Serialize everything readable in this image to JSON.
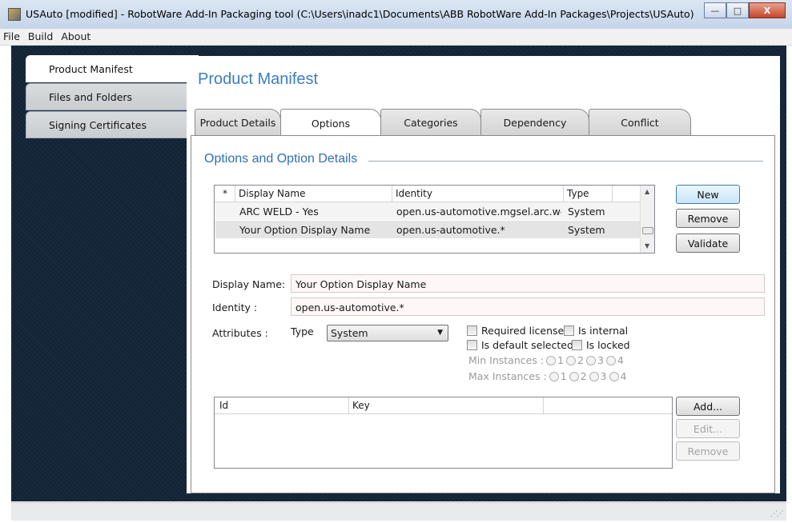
{
  "window": {
    "title": "USAuto [modified] - RobotWare Add-In Packaging tool (C:\\Users\\inadc1\\Documents\\ABB RobotWare Add-In Packages\\Projects\\USAuto)",
    "controls": {
      "minimize": "—",
      "maximize": "□",
      "close": "X"
    }
  },
  "menu": [
    "File",
    "Build",
    "About"
  ],
  "nav": [
    {
      "label": "Product Manifest",
      "active": true
    },
    {
      "label": "Files and Folders",
      "active": false
    },
    {
      "label": "Signing Certificates",
      "active": false
    }
  ],
  "page_title": "Product Manifest",
  "tabs": [
    "Product Details",
    "Options",
    "Categories",
    "Dependency",
    "Conflict"
  ],
  "active_tab": "Options",
  "section_title": "Options and Option Details",
  "options_grid": {
    "columns": [
      "*",
      "Display Name",
      "Identity",
      "Type"
    ],
    "rows": [
      {
        "display_name": "ARC WELD - Yes",
        "identity": "open.us-automotive.mgsel.arc.weld",
        "type": "System"
      },
      {
        "display_name": "Your Option Display Name",
        "identity": "open.us-automotive.*",
        "type": "System"
      }
    ]
  },
  "grid_buttons": {
    "new": "New",
    "remove": "Remove",
    "validate": "Validate"
  },
  "form": {
    "display_name_label": "Display Name:",
    "display_name_value": "Your Option Display Name",
    "identity_label": "Identity :",
    "identity_value": "open.us-automotive.*",
    "attributes_label": "Attributes :",
    "type_label": "Type",
    "type_value": "System",
    "required_license": "Required license",
    "is_internal": "Is internal",
    "is_default_selected": "Is default selected",
    "is_locked": "Is locked",
    "min_instances_label": "Min Instances :",
    "max_instances_label": "Max Instances :",
    "instance_options": [
      "1",
      "2",
      "3",
      "4"
    ]
  },
  "keys_grid": {
    "columns": [
      "Id",
      "Key"
    ]
  },
  "keys_buttons": {
    "add": "Add...",
    "edit": "Edit...",
    "remove": "Remove"
  },
  "colors": {
    "accent": "#3b7ec0",
    "frame_bg": "#122336",
    "tab_border": "#8a8a8a"
  },
  "icons": [
    "app-icon",
    "minimize-icon",
    "maximize-icon",
    "close-icon",
    "scroll-up-icon",
    "scroll-down-icon",
    "dropdown-arrow-icon",
    "resize-grip-icon"
  ]
}
